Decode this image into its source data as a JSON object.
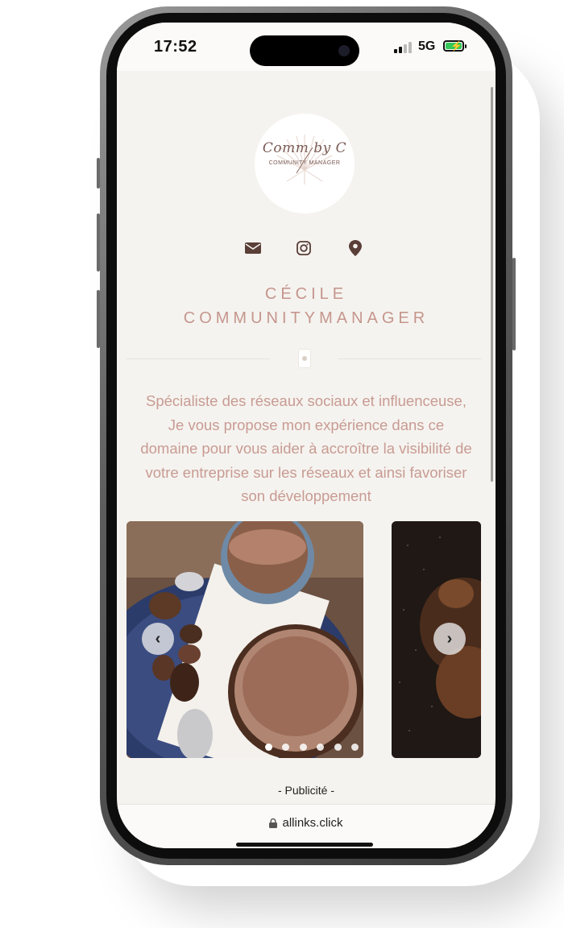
{
  "status_bar": {
    "time": "17:52",
    "network": "5G",
    "battery_charging": true
  },
  "profile": {
    "logo_text": "Comm by C",
    "logo_subtext": "COMMUNITY MANAGER",
    "name_line1": "CÉCILE",
    "name_line2": "COMMUNITYMANAGER",
    "bio_lines": [
      "Spécialiste des réseaux sociaux et influenceuse,",
      "Je vous propose mon expérience dans ce",
      "domaine pour vous aider à accroître la visibilité de",
      "votre entreprise sur les réseaux et ainsi favoriser",
      "son développement"
    ]
  },
  "socials": [
    {
      "icon": "envelope-icon"
    },
    {
      "icon": "instagram-icon"
    },
    {
      "icon": "location-pin-icon"
    }
  ],
  "carousel": {
    "slide_count": 6,
    "active_index": 0,
    "prev_label": "‹",
    "next_label": "›"
  },
  "ad": {
    "label": "- Publicité -"
  },
  "browser": {
    "url": "allinks.click"
  },
  "colors": {
    "accent_text": "#c5968d",
    "bio_text": "#c89b93",
    "background": "#f5f3ef",
    "icon_dark": "#5a3e38"
  }
}
